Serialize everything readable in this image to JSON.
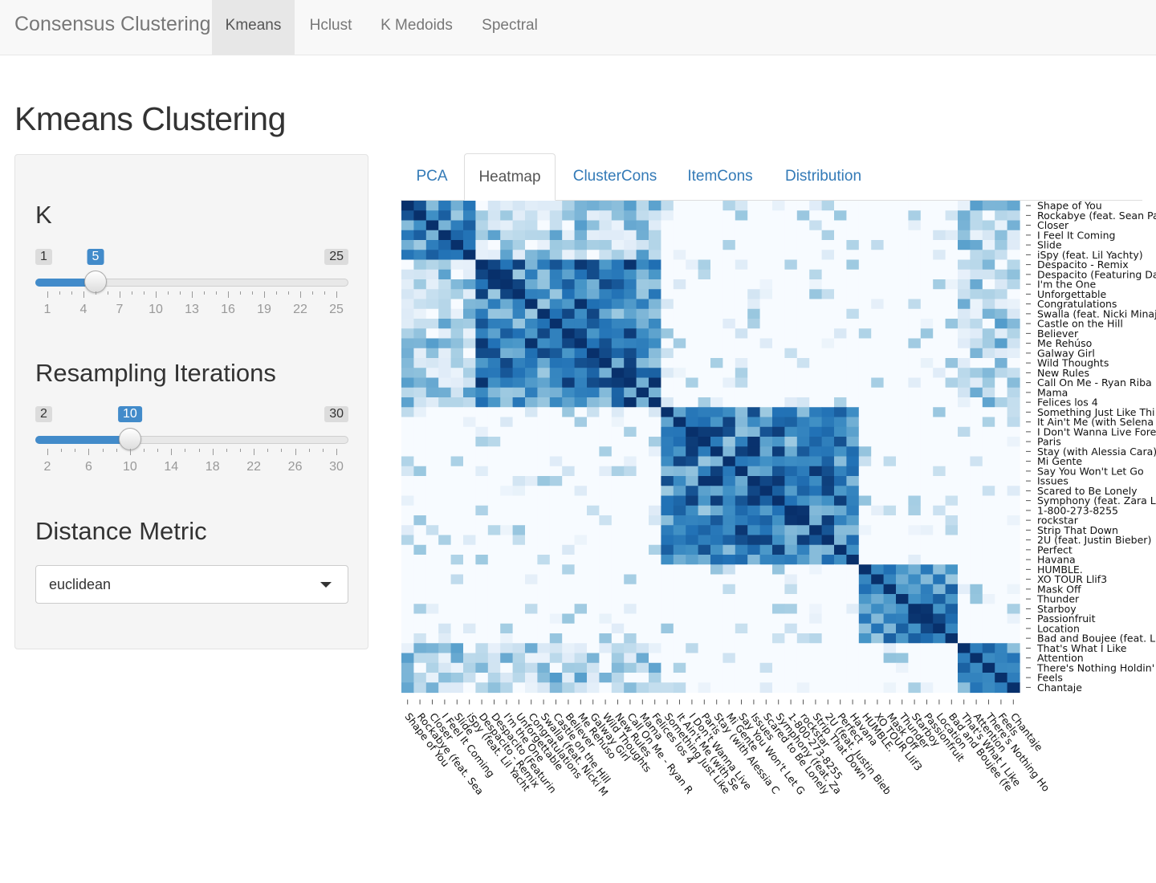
{
  "navbar": {
    "brand": "Consensus Clustering",
    "tabs": [
      "Kmeans",
      "Hclust",
      "K Medoids",
      "Spectral"
    ],
    "active": "Kmeans"
  },
  "page_title": "Kmeans Clustering",
  "controls": {
    "k": {
      "label": "K",
      "min": 1,
      "max": 25,
      "value": 5,
      "ticks": [
        "1",
        "4",
        "7",
        "10",
        "13",
        "16",
        "19",
        "22",
        "25"
      ]
    },
    "iterations": {
      "label": "Resampling Iterations",
      "min": 2,
      "max": 30,
      "value": 10,
      "ticks": [
        "2",
        "6",
        "10",
        "14",
        "18",
        "22",
        "26",
        "30"
      ]
    },
    "distance": {
      "label": "Distance Metric",
      "value": "euclidean"
    }
  },
  "result_tabs": [
    "PCA",
    "Heatmap",
    "ClusterCons",
    "ItemCons",
    "Distribution"
  ],
  "active_result_tab": "Heatmap",
  "colors": {
    "accent": "#428bca",
    "link": "#337ab7",
    "heat_low": "#f7fbff",
    "heat_high": "#08306b"
  },
  "chart_data": {
    "type": "heatmap",
    "title": "",
    "row_labels": [
      "Shape of You",
      "Rockabye (feat. Sean Pa",
      "Closer",
      "I Feel It Coming",
      "Slide",
      "iSpy (feat. Lil Yachty)",
      "Despacito - Remix",
      "Despacito (Featuring Da",
      "I'm the One",
      "Unforgettable",
      "Congratulations",
      "Swalla (feat. Nicki Minaj",
      "Castle on the Hill",
      "Believer",
      "Me Rehúso",
      "Galway Girl",
      "Wild Thoughts",
      "New Rules",
      "Call On Me - Ryan Riba",
      "Mama",
      "Felices los 4",
      "Something Just Like Thi",
      "It Ain't Me (with Selena",
      "I Don't Wanna Live Fore",
      "Paris",
      "Stay (with Alessia Cara)",
      "Mi Gente",
      "Say You Won't Let Go",
      "Issues",
      "Scared to Be Lonely",
      "Symphony (feat. Zara La",
      "1-800-273-8255",
      "rockstar",
      "Strip That Down",
      "2U (feat. Justin Bieber)",
      "Perfect",
      "Havana",
      "HUMBLE.",
      "XO TOUR Llif3",
      "Mask Off",
      "Thunder",
      "Starboy",
      "Passionfruit",
      "Location",
      "Bad and Boujee (feat. Li",
      "That's What I Like",
      "Attention",
      "There's Nothing Holdin'",
      "Feels",
      "Chantaje"
    ],
    "col_labels": [
      "Shape of You",
      "Rockabye (feat. Sea",
      "Closer",
      "I Feel It Coming",
      "Slide",
      "iSpy (feat. Lil Yacht",
      "Despacito - Remix",
      "Despacito (Featurin",
      "I'm the One",
      "Unforgettable",
      "Congratulations",
      "Swalla (feat. Nicki M",
      "Castle on the Hill",
      "Believer",
      "Me Rehúso",
      "Galway Girl",
      "Wild Thoughts",
      "New Rules",
      "Call On Me - Ryan R",
      "Mama",
      "Felices los 4",
      "Something Just Like",
      "It Ain't Me (with Se",
      "I Don't Wanna Live",
      "Paris",
      "Stay (with Alessia C",
      "Mi Gente",
      "Say You Won't Let G",
      "Issues",
      "Scared to Be Lonely",
      "Symphony (feat. Za",
      "1-800-273-8255",
      "rockstar",
      "Strip That Down",
      "2U (feat. Justin Bieb",
      "Perfect",
      "Havana",
      "HUMBLE.",
      "XO TOUR Llif3",
      "Mask Off",
      "Thunder",
      "Starboy",
      "Passionfruit",
      "Location",
      "Bad and Boujee (fe",
      "That's What I Like",
      "Attention",
      "There's Nothing Ho",
      "Feels",
      "Chantaje"
    ],
    "clusters": [
      {
        "start": 0,
        "end": 5
      },
      {
        "start": 6,
        "end": 20
      },
      {
        "start": 21,
        "end": 36
      },
      {
        "start": 37,
        "end": 44
      },
      {
        "start": 45,
        "end": 49
      }
    ],
    "value_range": [
      0,
      1
    ],
    "colorscale": "Blues"
  }
}
